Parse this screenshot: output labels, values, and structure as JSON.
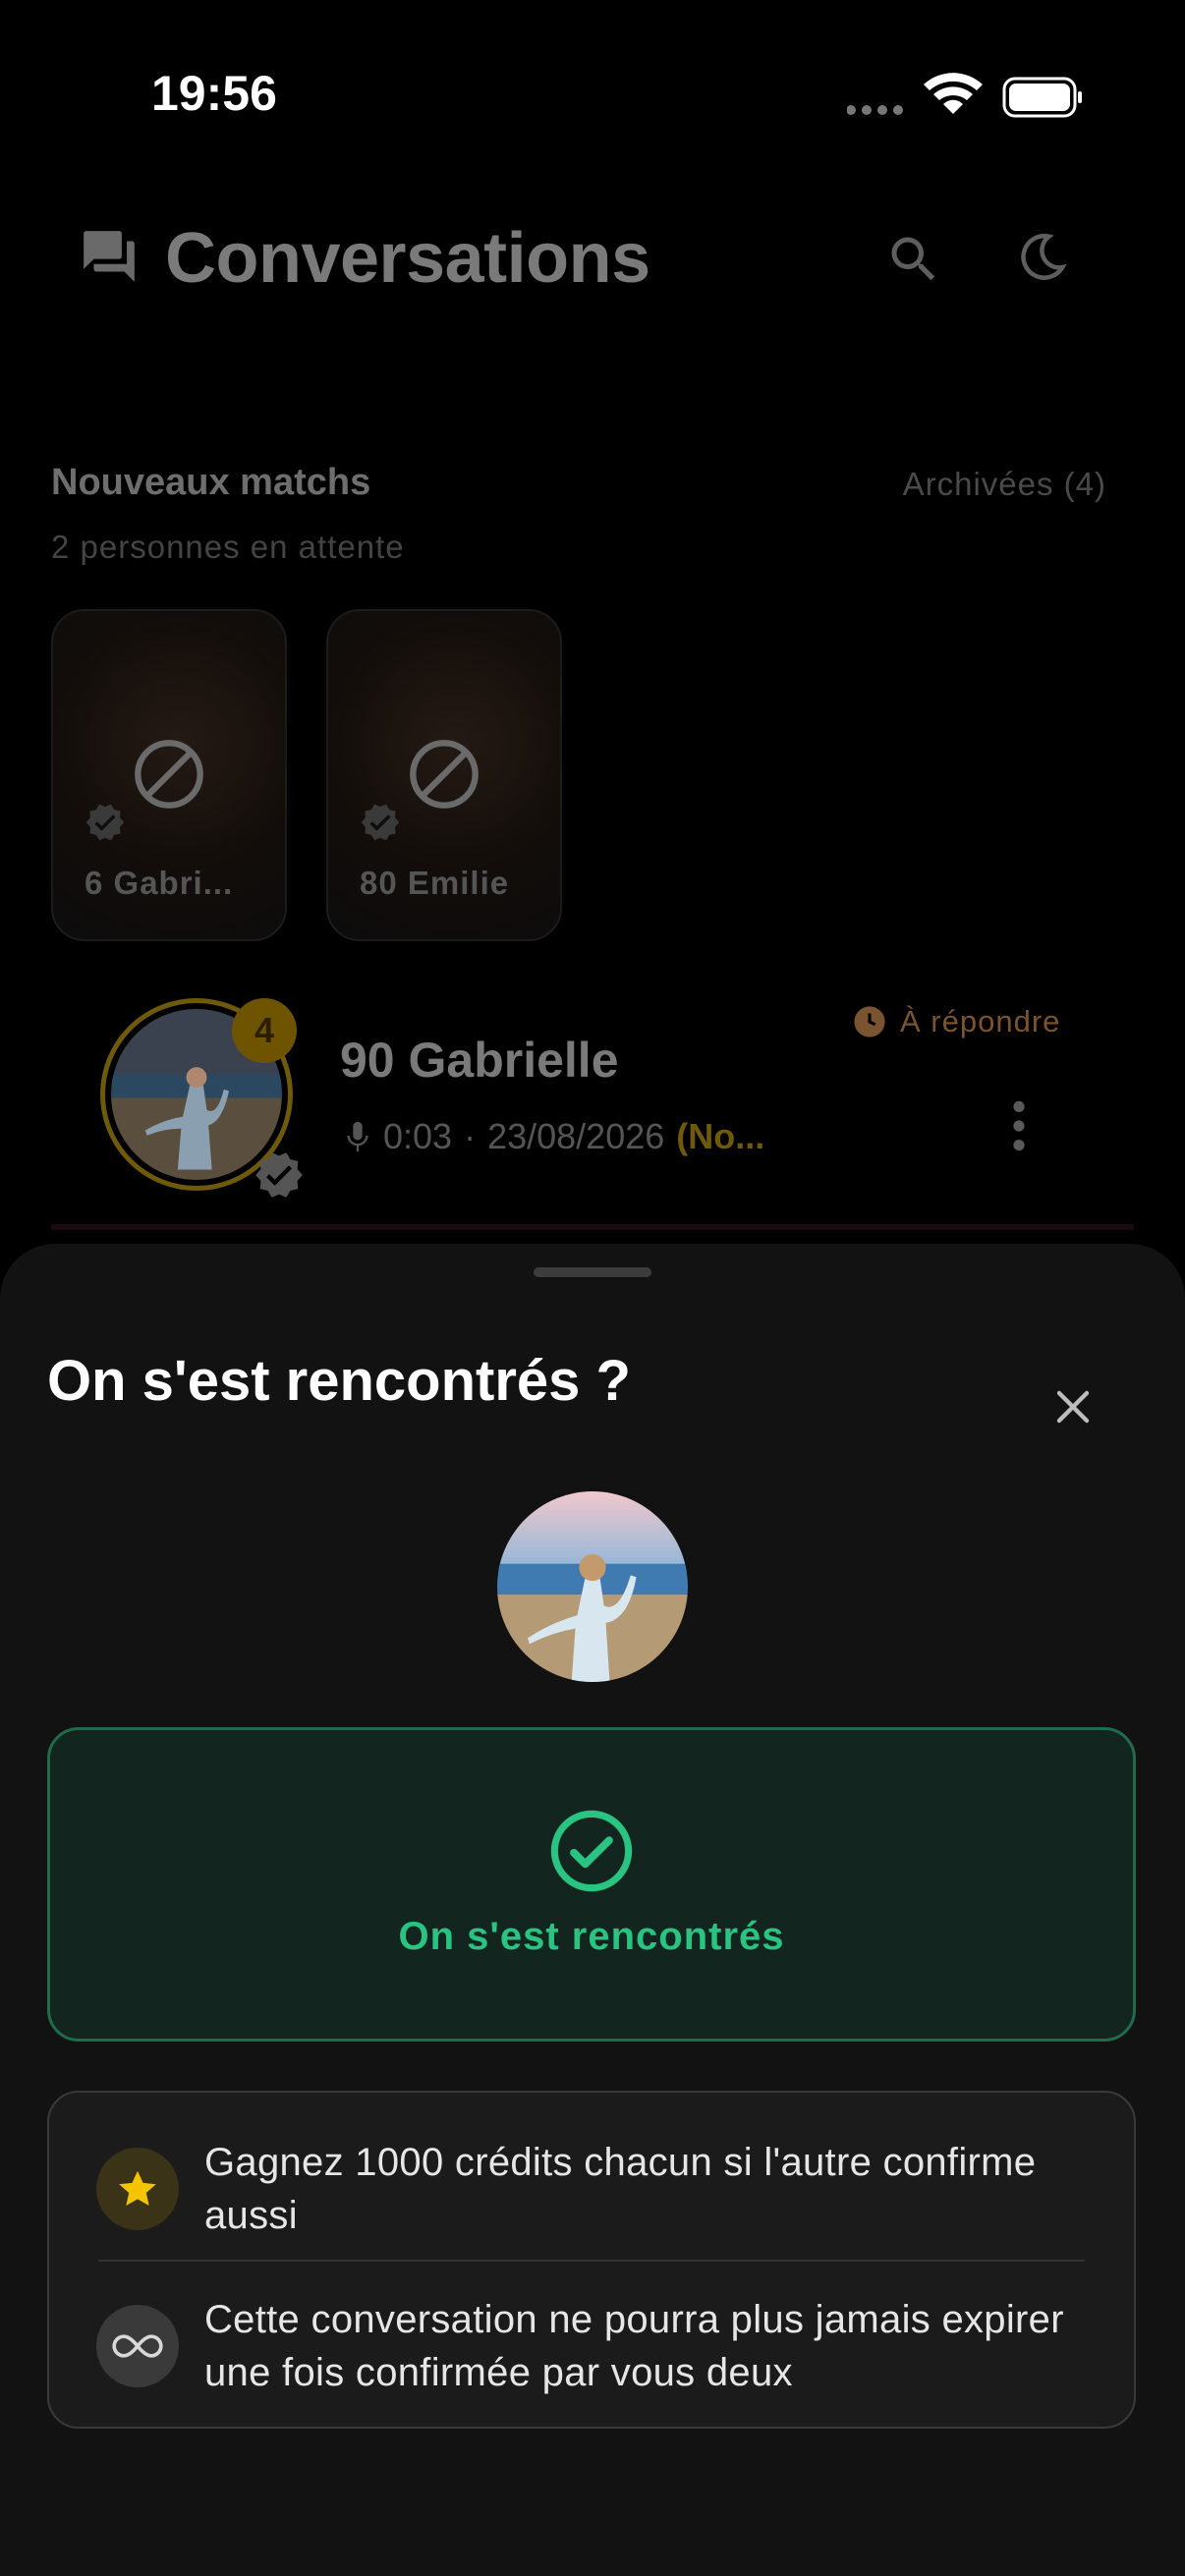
{
  "status_bar": {
    "time": "19:56"
  },
  "header": {
    "title": "Conversations",
    "icons": [
      "chat-icon",
      "search-icon",
      "moon-icon"
    ]
  },
  "new_matches": {
    "title": "Nouveaux matchs",
    "subtitle": "2 personnes en attente",
    "archived_link": "Archivées (4)",
    "cards": [
      {
        "name": "6 Gabri..."
      },
      {
        "name": "80 Emilie"
      }
    ]
  },
  "conversation": {
    "name": "90 Gabrielle",
    "unread_count": "4",
    "status": "À répondre",
    "duration": "0:03",
    "separator": "·",
    "date": "23/08/2026",
    "tag": "(No..."
  },
  "sheet": {
    "title": "On s'est rencontrés ?",
    "primary_button": "On s'est rencontrés",
    "info": [
      {
        "icon": "star-icon",
        "text": "Gagnez 1000 crédits chacun si l'autre confirme aussi"
      },
      {
        "icon": "infinity-icon",
        "text": "Cette conversation ne pourra plus jamais expirer une fois confirmée par vous deux"
      }
    ]
  },
  "colors": {
    "accent_green": "#29c382",
    "gold": "#f5c400",
    "pending_orange": "#c9853a"
  }
}
